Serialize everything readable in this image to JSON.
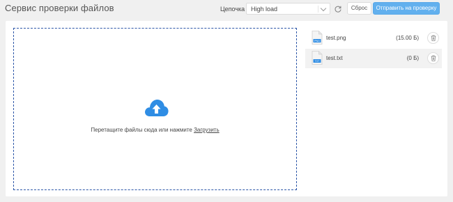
{
  "header": {
    "title": "Сервис проверки файлов",
    "chain_label": "Цепочка",
    "chain_value": "High load",
    "reset_label": "Сброс",
    "submit_label": "Отправить на проверку"
  },
  "dropzone": {
    "prompt": "Перетащите файлы сюда или нажмите ",
    "link": "Загрузить"
  },
  "files": [
    {
      "name": "test.png",
      "size": "(15.00 Б)",
      "type": "PNG",
      "highlighted": false
    },
    {
      "name": "test.txt",
      "size": "(0 Б)",
      "type": "TXT",
      "highlighted": true
    }
  ],
  "colors": {
    "accent": "#62b0ee",
    "dashed_border": "#2c56a8",
    "icon_blue": "#2f8de4"
  },
  "icons": [
    "chevron-down-icon",
    "refresh-icon",
    "cloud-upload-icon",
    "file-png-icon",
    "file-txt-icon",
    "trash-icon"
  ]
}
